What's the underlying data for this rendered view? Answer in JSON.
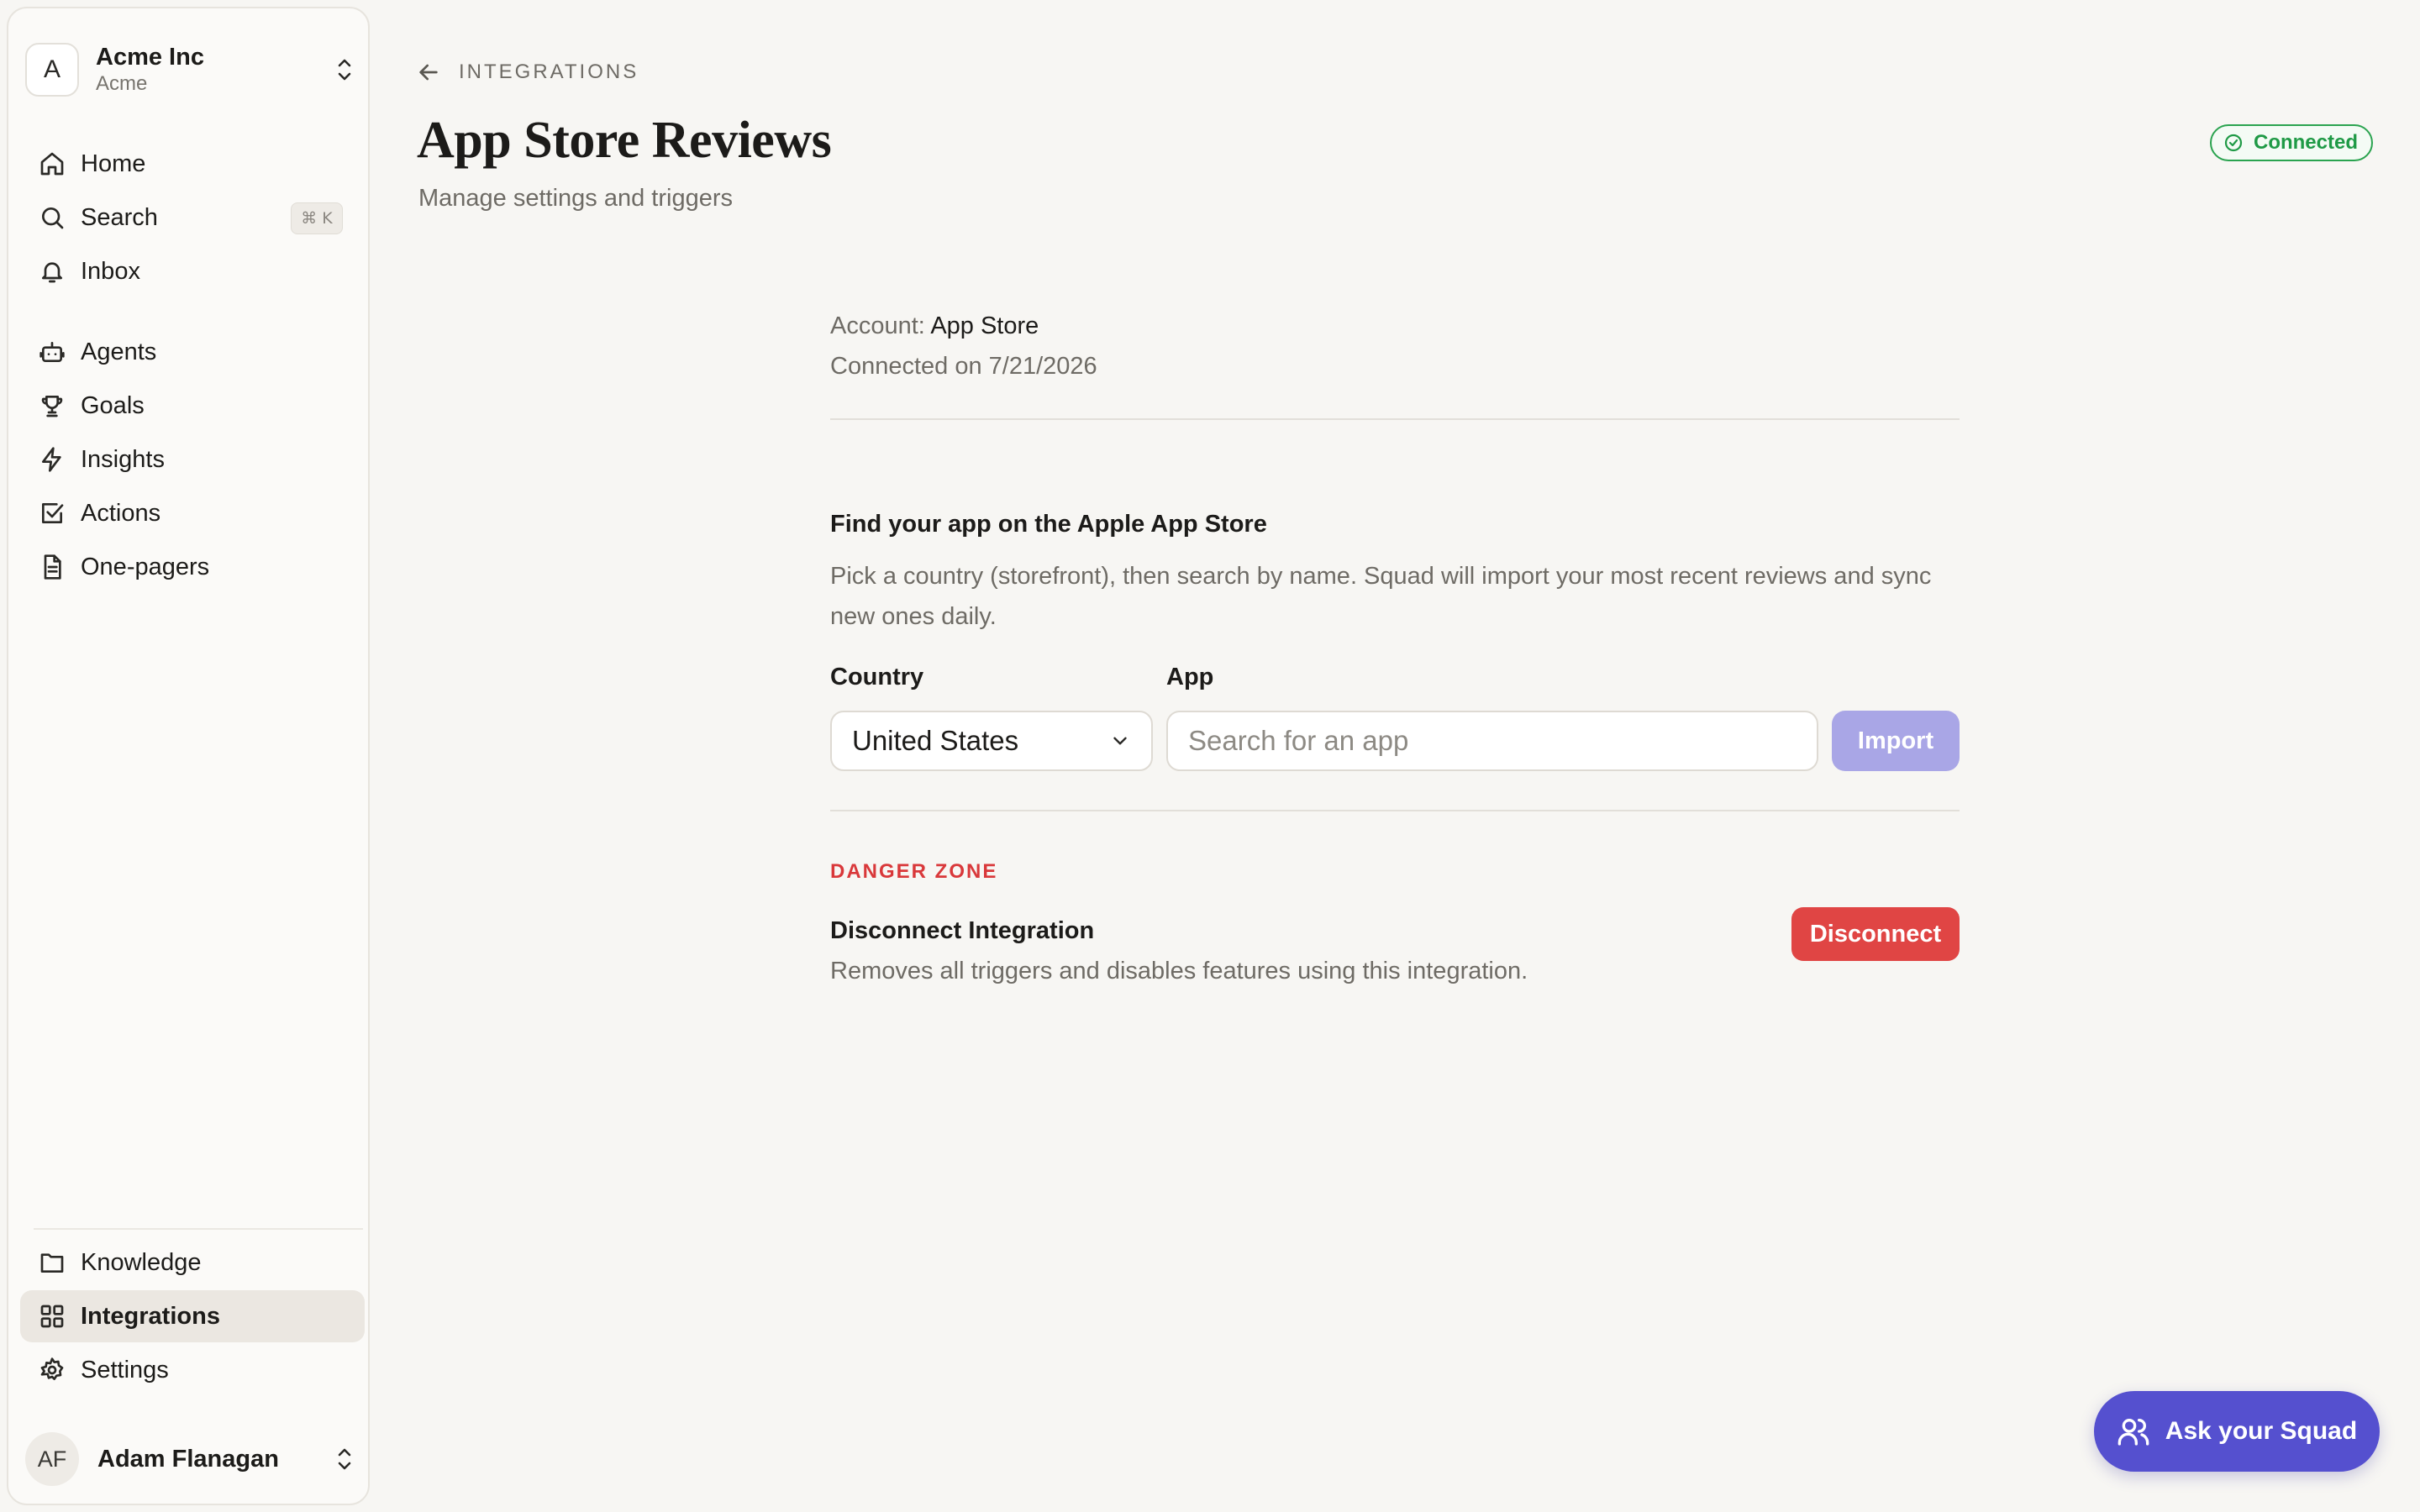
{
  "org": {
    "avatar": "A",
    "name": "Acme Inc",
    "sub": "Acme"
  },
  "nav": {
    "home": "Home",
    "search": "Search",
    "search_shortcut": "⌘ K",
    "inbox": "Inbox",
    "agents": "Agents",
    "goals": "Goals",
    "insights": "Insights",
    "actions": "Actions",
    "onepagers": "One-pagers",
    "knowledge": "Knowledge",
    "integrations": "Integrations",
    "settings": "Settings"
  },
  "user": {
    "initials": "AF",
    "name": "Adam Flanagan"
  },
  "header": {
    "breadcrumb": "INTEGRATIONS",
    "title": "App Store Reviews",
    "subtitle": "Manage settings and triggers",
    "status": "Connected"
  },
  "account": {
    "label": "Account:",
    "value": "App Store",
    "connected_on": "Connected on 7/21/2026"
  },
  "finder": {
    "title": "Find your app on the Apple App Store",
    "description": "Pick a country (storefront), then search by name. Squad will import your most recent reviews and sync new ones daily.",
    "country_label": "Country",
    "country_value": "United States",
    "app_label": "App",
    "app_placeholder": "Search for an app",
    "import_label": "Import"
  },
  "danger": {
    "heading": "DANGER ZONE",
    "title": "Disconnect Integration",
    "description": "Removes all triggers and disables features using this integration.",
    "button": "Disconnect"
  },
  "assistant": {
    "label": "Ask your Squad"
  },
  "colors": {
    "accent": "#5550cf",
    "danger": "#e04544",
    "success": "#1f9a46",
    "import_disabled": "#a9a6e6"
  },
  "icons": [
    "home-icon",
    "search-icon",
    "bell-icon",
    "bot-icon",
    "trophy-icon",
    "bolt-icon",
    "checkbox-icon",
    "document-icon",
    "folder-icon",
    "grid-icon",
    "gear-icon",
    "arrow-left-icon",
    "check-circle-icon",
    "chevron-down-icon",
    "chevron-updown-icon",
    "users-icon"
  ]
}
